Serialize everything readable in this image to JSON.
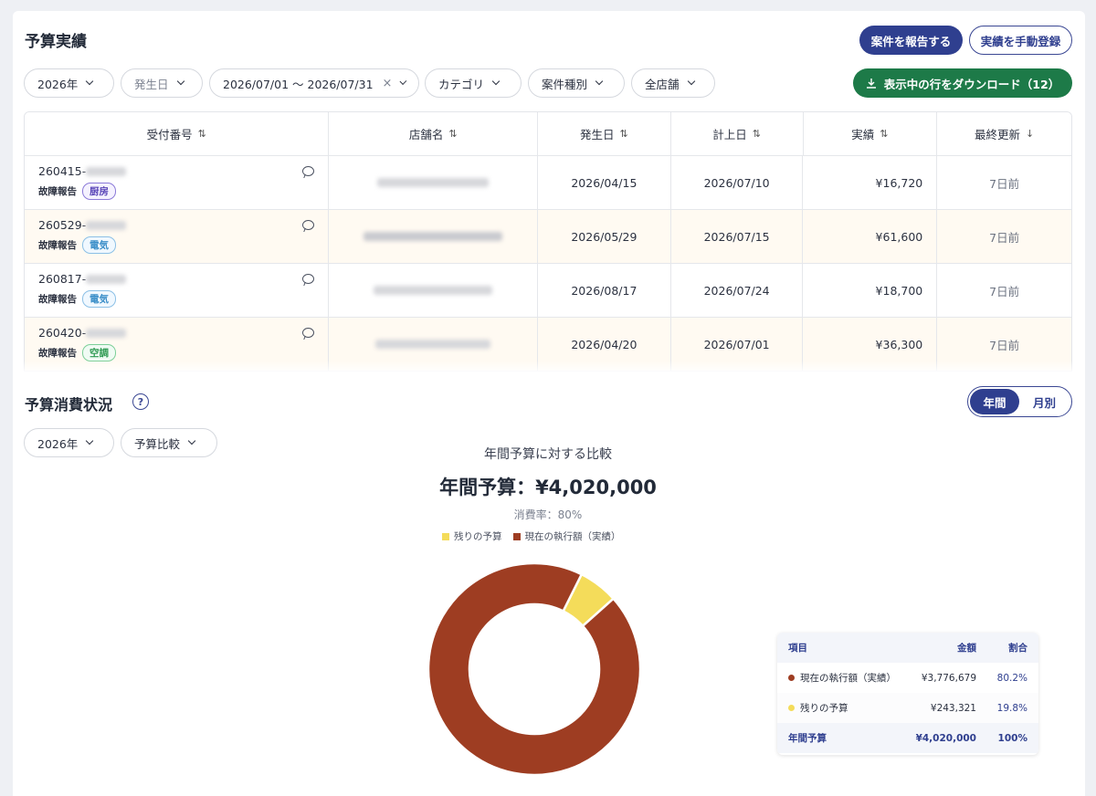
{
  "colors": {
    "primary": "#2f3f8f",
    "green": "#1d7a48",
    "executed": "#9e3d22",
    "remaining": "#f4dc5a"
  },
  "header": {
    "title": "予算実績",
    "report_button": "案件を報告する",
    "manual_button": "実績を手動登録"
  },
  "filters": {
    "year": "2026年",
    "occurrence_date": "発生日",
    "date_range": "2026/07/01 〜 2026/07/31",
    "clear_icon": "×",
    "category": "カテゴリ",
    "case_type": "案件種別",
    "store": "全店舗",
    "download_button": "表示中の行をダウンロード（12）"
  },
  "table": {
    "columns": [
      "受付番号",
      "店舗名",
      "発生日",
      "計上日",
      "実績",
      "最終更新"
    ],
    "sort_icons": [
      "⇅",
      "⇅",
      "⇅",
      "⇅",
      "⇅",
      "↓"
    ],
    "rows": [
      {
        "id": "260415-",
        "type": "故障報告",
        "tag": "厨房",
        "occurred": "2026/04/15",
        "booked": "2026/07/10",
        "amount": "¥16,720",
        "updated": "7日前"
      },
      {
        "id": "260529-",
        "type": "故障報告",
        "tag": "電気",
        "occurred": "2026/05/29",
        "booked": "2026/07/15",
        "amount": "¥61,600",
        "updated": "7日前"
      },
      {
        "id": "260817-",
        "type": "故障報告",
        "tag": "電気",
        "occurred": "2026/08/17",
        "booked": "2026/07/24",
        "amount": "¥18,700",
        "updated": "7日前"
      },
      {
        "id": "260420-",
        "type": "故障報告",
        "tag": "空調",
        "occurred": "2026/04/20",
        "booked": "2026/07/01",
        "amount": "¥36,300",
        "updated": "7日前"
      }
    ]
  },
  "budget": {
    "title": "予算消費状況",
    "help": "?",
    "toggle": {
      "annual": "年間",
      "monthly": "月別"
    },
    "year_filter": "2026年",
    "compare_filter": "予算比較",
    "chart_heading": "年間予算に対する比較",
    "annual_budget": "年間予算：¥4,020,000",
    "consumption_rate": "消費率：80%",
    "legend": {
      "remaining": "残りの予算",
      "executed": "現在の執行額（実績）"
    },
    "summary": {
      "headers": [
        "項目",
        "金額",
        "割合"
      ],
      "rows": [
        {
          "label": "現在の執行額（実績）",
          "amount": "¥3,776,679",
          "ratio": "80.2%"
        },
        {
          "label": "残りの予算",
          "amount": "¥243,321",
          "ratio": "19.8%"
        }
      ],
      "total": {
        "label": "年間予算",
        "amount": "¥4,020,000",
        "ratio": "100%"
      }
    }
  },
  "chart_data": {
    "type": "pie",
    "title": "年間予算に対する比較",
    "categories": [
      "残りの予算",
      "現在の執行額（実績）"
    ],
    "values": [
      243321,
      3776679
    ],
    "percentages": [
      19.8,
      80.2
    ],
    "donut": true
  }
}
